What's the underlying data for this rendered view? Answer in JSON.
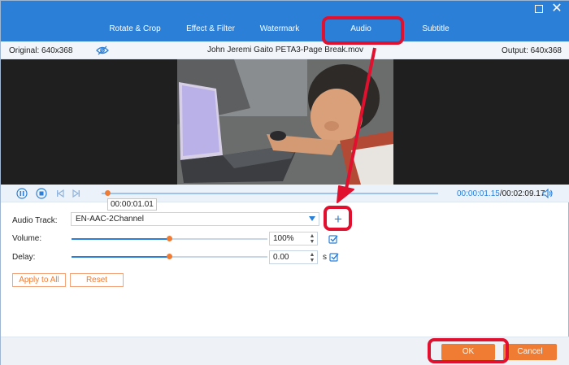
{
  "tabs": [
    {
      "label": "Rotate & Crop"
    },
    {
      "label": "Effect & Filter"
    },
    {
      "label": "Watermark"
    },
    {
      "label": "Audio"
    },
    {
      "label": "Subtitle"
    }
  ],
  "info": {
    "original": "Original: 640x368",
    "filename": "John Jeremi Gaito PETA3-Page Break.mov",
    "output": "Output: 640x368"
  },
  "playback": {
    "current": "00:00:01.15",
    "duration": "/00:02:09.17",
    "tooltip": "00:00:01.01",
    "progress_fraction": 0.01
  },
  "audio": {
    "track_label": "Audio Track:",
    "track_value": "EN-AAC-2Channel",
    "add_symbol": "+",
    "volume_label": "Volume:",
    "volume_value": "100%",
    "volume_fraction": 0.5,
    "delay_label": "Delay:",
    "delay_value": "0.00",
    "delay_fraction": 0.5,
    "delay_unit": "s"
  },
  "buttons": {
    "apply_all": "Apply to All",
    "reset": "Reset",
    "ok": "OK",
    "cancel": "Cancel"
  },
  "colors": {
    "accent": "#2b7fd6",
    "orange": "#f07b32",
    "highlight": "#e0102e"
  }
}
